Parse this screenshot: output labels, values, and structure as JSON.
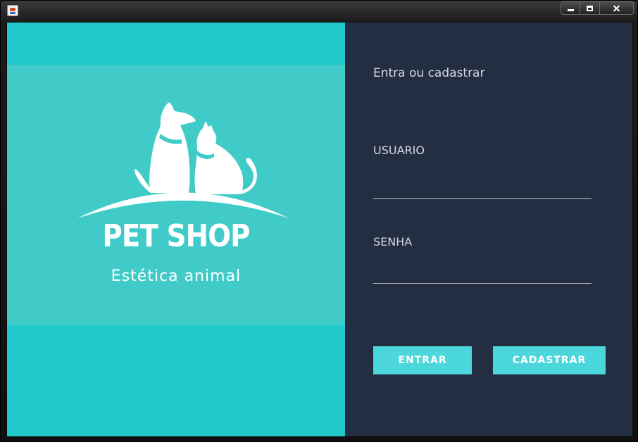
{
  "window": {
    "controls": [
      "minimize-icon",
      "maximize-icon",
      "close-icon"
    ]
  },
  "brand_panel": {
    "title": "PET SHOP",
    "tagline": "Estética animal",
    "colors": {
      "background": "#1fc8c9",
      "band": "#40cbc9"
    },
    "logo_icon": "dog-and-cat-icon"
  },
  "login_panel": {
    "heading": "Entra ou cadastrar",
    "username": {
      "label": "USUARIO",
      "value": ""
    },
    "password": {
      "label": "SENHA",
      "value": ""
    },
    "buttons": {
      "login": "ENTRAR",
      "register": "CADASTRAR"
    },
    "colors": {
      "background": "#232e42",
      "button": "#4bd7db"
    }
  }
}
